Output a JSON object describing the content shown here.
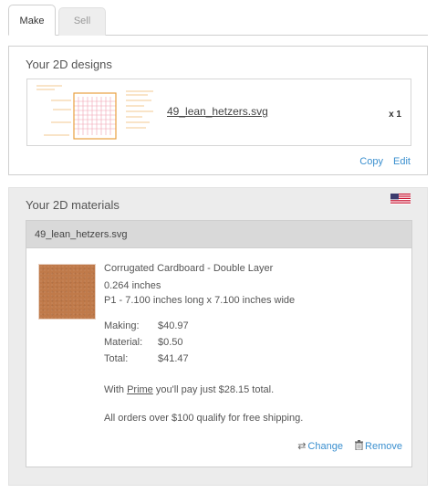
{
  "tabs": [
    {
      "label": "Make",
      "active": true
    },
    {
      "label": "Sell",
      "active": false
    }
  ],
  "designs": {
    "title": "Your 2D designs",
    "item": {
      "filename": "49_lean_hetzers.svg",
      "quantity": "x 1"
    },
    "actions": {
      "copy": "Copy",
      "edit": "Edit"
    }
  },
  "materials": {
    "title": "Your 2D materials",
    "flag_icon": "us-flag-icon",
    "card": {
      "filename": "49_lean_hetzers.svg",
      "material_name": "Corrugated Cardboard - Double Layer",
      "thickness": "0.264 inches",
      "dimensions": "P1 - 7.100 inches long x 7.100 inches wide",
      "prices": {
        "making_label": "Making:",
        "making_value": "$40.97",
        "material_label": "Material:",
        "material_value": "$0.50",
        "total_label": "Total:",
        "total_value": "$41.47"
      },
      "prime_prefix": "With ",
      "prime_link": "Prime",
      "prime_suffix": " you'll pay just $28.15 total.",
      "shipping_note": "All orders over $100 qualify for free shipping.",
      "actions": {
        "change": "Change",
        "remove": "Remove"
      }
    }
  },
  "colors": {
    "link": "#3a8fcf",
    "material_swatch": "#c07a4a",
    "design_outline": "#e8a040",
    "design_grid": "#f0a0b0"
  }
}
